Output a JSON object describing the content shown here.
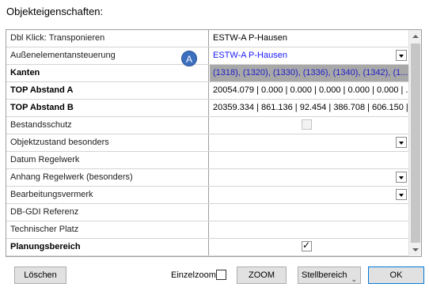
{
  "window": {
    "title": "Objekteigenschaften:"
  },
  "rows": [
    {
      "key": "Dbl Klick: Transponieren",
      "value": "ESTW-A P-Hausen",
      "bold": false
    },
    {
      "key": "Außenelementansteuerung",
      "value": "ESTW-A P-Hausen",
      "bold": false,
      "dropdown": true,
      "link": true,
      "badge": "A"
    },
    {
      "key": "Kanten",
      "value": "(1318), (1320), (1330), (1336), (1340), (1342), (1...",
      "bold": true,
      "selected": true
    },
    {
      "key": "TOP Abstand A",
      "value": "20054.079 | 0.000 | 0.000 | 0.000 | 0.000 | 0.000 | ...",
      "bold": true
    },
    {
      "key": "TOP Abstand B",
      "value": "20359.334 | 861.136 | 92.454 | 386.708 | 606.150 | ...",
      "bold": true
    },
    {
      "key": "Bestandsschutz",
      "value": "",
      "bold": false,
      "checkbox": "disabled"
    },
    {
      "key": "Objektzustand besonders",
      "value": "",
      "bold": false,
      "dropdown": true
    },
    {
      "key": "Datum Regelwerk",
      "value": "",
      "bold": false
    },
    {
      "key": "Anhang Regelwerk (besonders)",
      "value": "",
      "bold": false,
      "dropdown": true
    },
    {
      "key": "Bearbeitungsvermerk",
      "value": "",
      "bold": false,
      "dropdown": true
    },
    {
      "key": "DB-GDI Referenz",
      "value": "",
      "bold": false
    },
    {
      "key": "Technischer Platz",
      "value": "",
      "bold": false
    },
    {
      "key": "Planungsbereich",
      "value": "",
      "bold": true,
      "checkbox": "checked"
    }
  ],
  "footer": {
    "delete_label": "Löschen",
    "single_zoom_label": "Einzelzoom",
    "zoom_label": "ZOOM",
    "area_select_value": "Stellbereich",
    "ok_label": "OK"
  },
  "icons": {
    "badge": "annotation-badge-a",
    "dropdown": "chevron-down-icon",
    "checkbox": "checkbox"
  },
  "colors": {
    "selected_row_bg": "#a8a8a8",
    "link_text": "#1a1aff",
    "badge_bg": "#3d6fbf",
    "ok_border": "#0078d7"
  }
}
